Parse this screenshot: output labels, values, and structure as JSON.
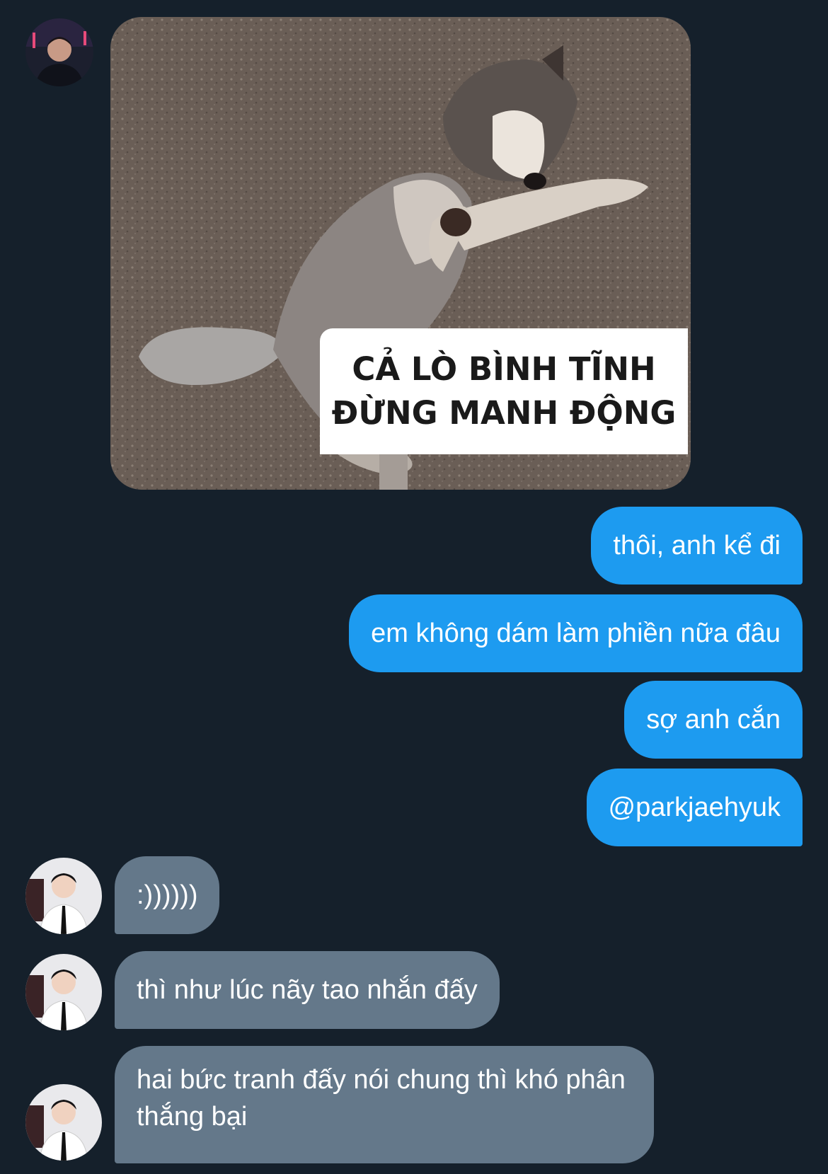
{
  "conversation": {
    "top_message": {
      "avatar_icon": "user-avatar-icon",
      "image_caption": [
        "CẢ LÒ BÌNH TĨNH",
        "ĐỪNG MANH ĐỘNG"
      ],
      "image_subject": "dog-meme-image"
    },
    "sent": [
      "thôi, anh kể đi",
      "em không dám làm phiền nữa đâu",
      "sợ anh cắn",
      "@parkjaehyuk"
    ],
    "received": [
      ":))))))",
      "thì như lúc nãy tao nhắn đấy",
      "hai bức tranh đấy nói chung thì khó phân thắng bại"
    ]
  },
  "colors": {
    "background": "#15202b",
    "sent_bubble": "#1d9bf0",
    "received_bubble": "#64788a"
  }
}
